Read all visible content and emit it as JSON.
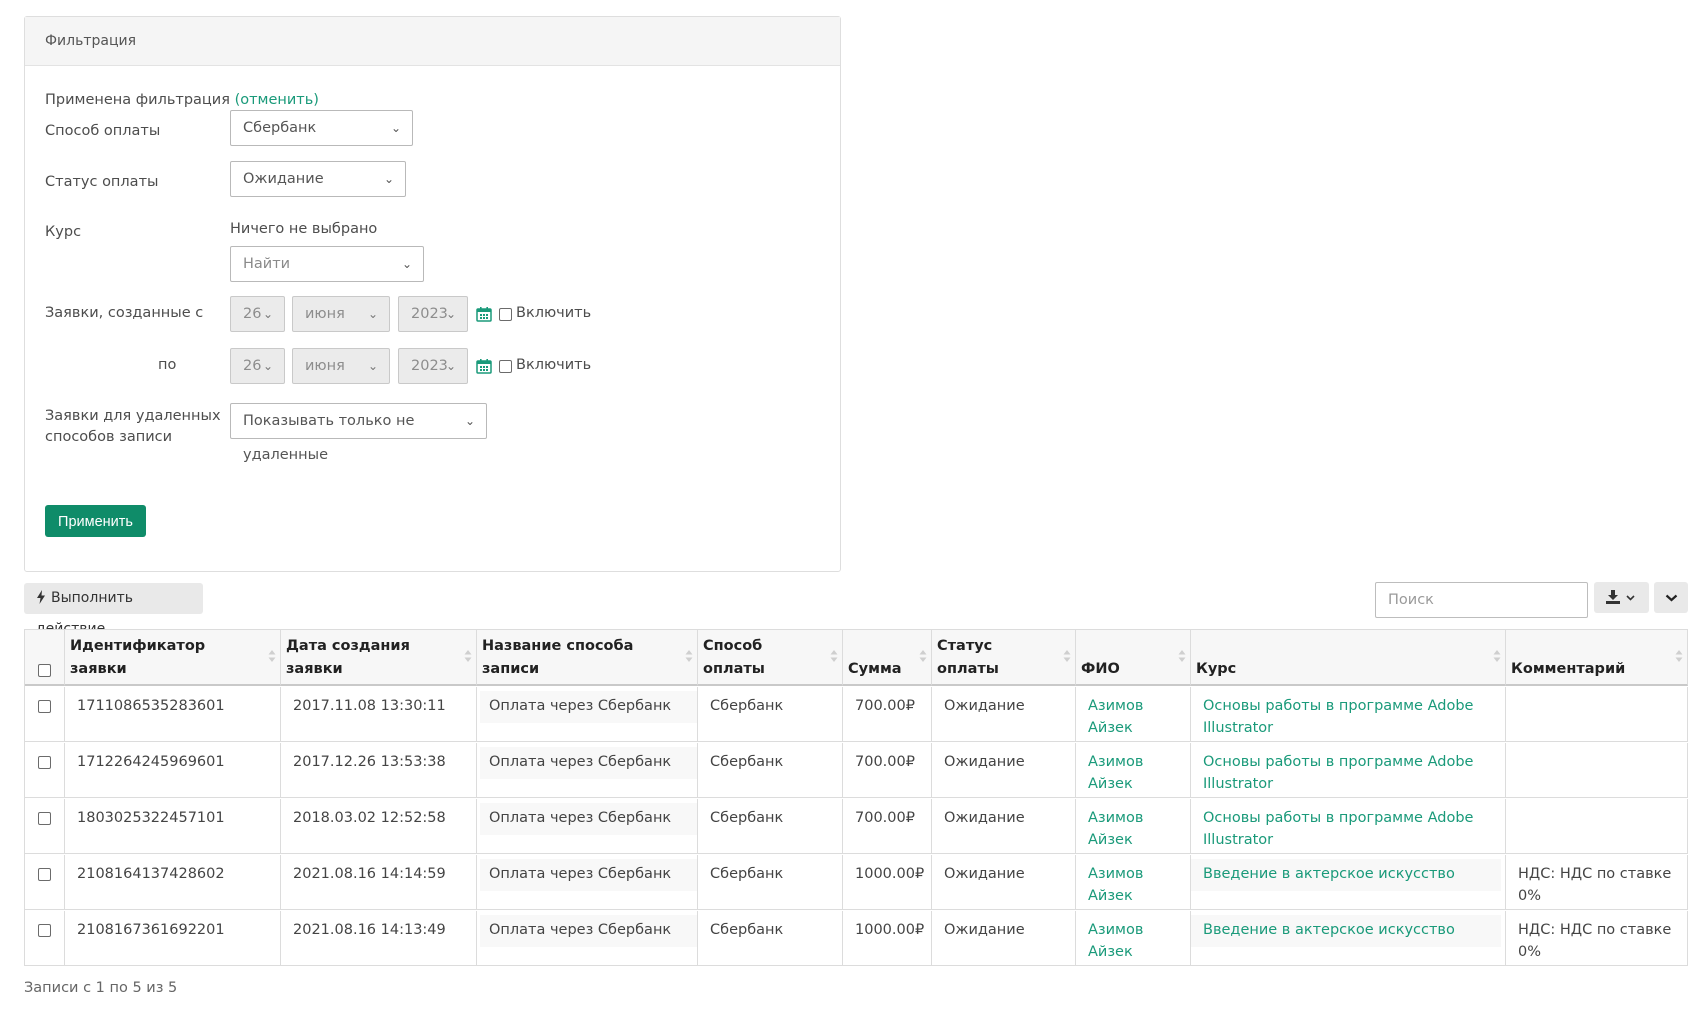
{
  "filter": {
    "title": "Фильтрация",
    "applied_text": "Применена фильтрация",
    "cancel_link": "(отменить)",
    "payment_method": {
      "label": "Способ оплаты",
      "value": "Сбербанк"
    },
    "payment_status": {
      "label": "Статус оплаты",
      "value": "Ожидание"
    },
    "course": {
      "label": "Курс",
      "nothing_selected": "Ничего не выбрано",
      "search_placeholder": "Найти"
    },
    "created_from": {
      "label": "Заявки, созданные с",
      "day": "26",
      "month": "июня",
      "year": "2023",
      "enable_label": "Включить"
    },
    "created_to": {
      "label": "по",
      "day": "26",
      "month": "июня",
      "year": "2023",
      "enable_label": "Включить"
    },
    "deleted_methods": {
      "label_line1": "Заявки для удаленных",
      "label_line2": "способов записи",
      "value": "Показывать только не удаленные"
    },
    "apply_button": "Применить"
  },
  "toolbar": {
    "action_button": "Выполнить действие",
    "search_placeholder": "Поиск",
    "icons": [
      "download-icon",
      "chevron-down-icon"
    ]
  },
  "table": {
    "headers": [
      {
        "line1": "Идентификатор",
        "line2": "заявки"
      },
      {
        "line1": "Дата создания",
        "line2": "заявки"
      },
      {
        "line1": "Название способа",
        "line2": "записи"
      },
      {
        "line1": "Способ",
        "line2": "оплаты"
      },
      {
        "line1": "",
        "line2": "Сумма"
      },
      {
        "line1": "Статус",
        "line2": "оплаты"
      },
      {
        "line1": "",
        "line2": "ФИО"
      },
      {
        "line1": "",
        "line2": "Курс"
      },
      {
        "line1": "",
        "line2": "Комментарий"
      }
    ],
    "rows": [
      {
        "id": "1711086535283601",
        "date": "2017.11.08 13:30:11",
        "method_name": "Оплата через Сбербанк",
        "payment": "Сбербанк",
        "sum": "700.00₽",
        "status": "Ожидание",
        "fio1": "Азимов",
        "fio2": "Айзек",
        "course1": "Основы работы в программе Adobe",
        "course2": "Illustrator",
        "comment1": "",
        "comment2": ""
      },
      {
        "id": "1712264245969601",
        "date": "2017.12.26 13:53:38",
        "method_name": "Оплата через Сбербанк",
        "payment": "Сбербанк",
        "sum": "700.00₽",
        "status": "Ожидание",
        "fio1": "Азимов",
        "fio2": "Айзек",
        "course1": "Основы работы в программе Adobe",
        "course2": "Illustrator",
        "comment1": "",
        "comment2": ""
      },
      {
        "id": "1803025322457101",
        "date": "2018.03.02 12:52:58",
        "method_name": "Оплата через Сбербанк",
        "payment": "Сбербанк",
        "sum": "700.00₽",
        "status": "Ожидание",
        "fio1": "Азимов",
        "fio2": "Айзек",
        "course1": "Основы работы в программе Adobe",
        "course2": "Illustrator",
        "comment1": "",
        "comment2": ""
      },
      {
        "id": "2108164137428602",
        "date": "2021.08.16 14:14:59",
        "method_name": "Оплата через Сбербанк",
        "payment": "Сбербанк",
        "sum": "1000.00₽",
        "status": "Ожидание",
        "fio1": "Азимов",
        "fio2": "Айзек",
        "course1": "Введение в актерское искусство",
        "course2": "",
        "comment1": "НДС: НДС по ставке",
        "comment2": "0%"
      },
      {
        "id": "2108167361692201",
        "date": "2021.08.16 14:13:49",
        "method_name": "Оплата через Сбербанк",
        "payment": "Сбербанк",
        "sum": "1000.00₽",
        "status": "Ожидание",
        "fio1": "Азимов",
        "fio2": "Айзек",
        "course1": "Введение в актерское искусство",
        "course2": "",
        "comment1": "НДС: НДС по ставке",
        "comment2": "0%"
      }
    ]
  },
  "footer": {
    "info": "Записи с 1 по 5 из 5"
  },
  "colors": {
    "accent": "#0f8c69",
    "link": "#1a9a7a"
  }
}
